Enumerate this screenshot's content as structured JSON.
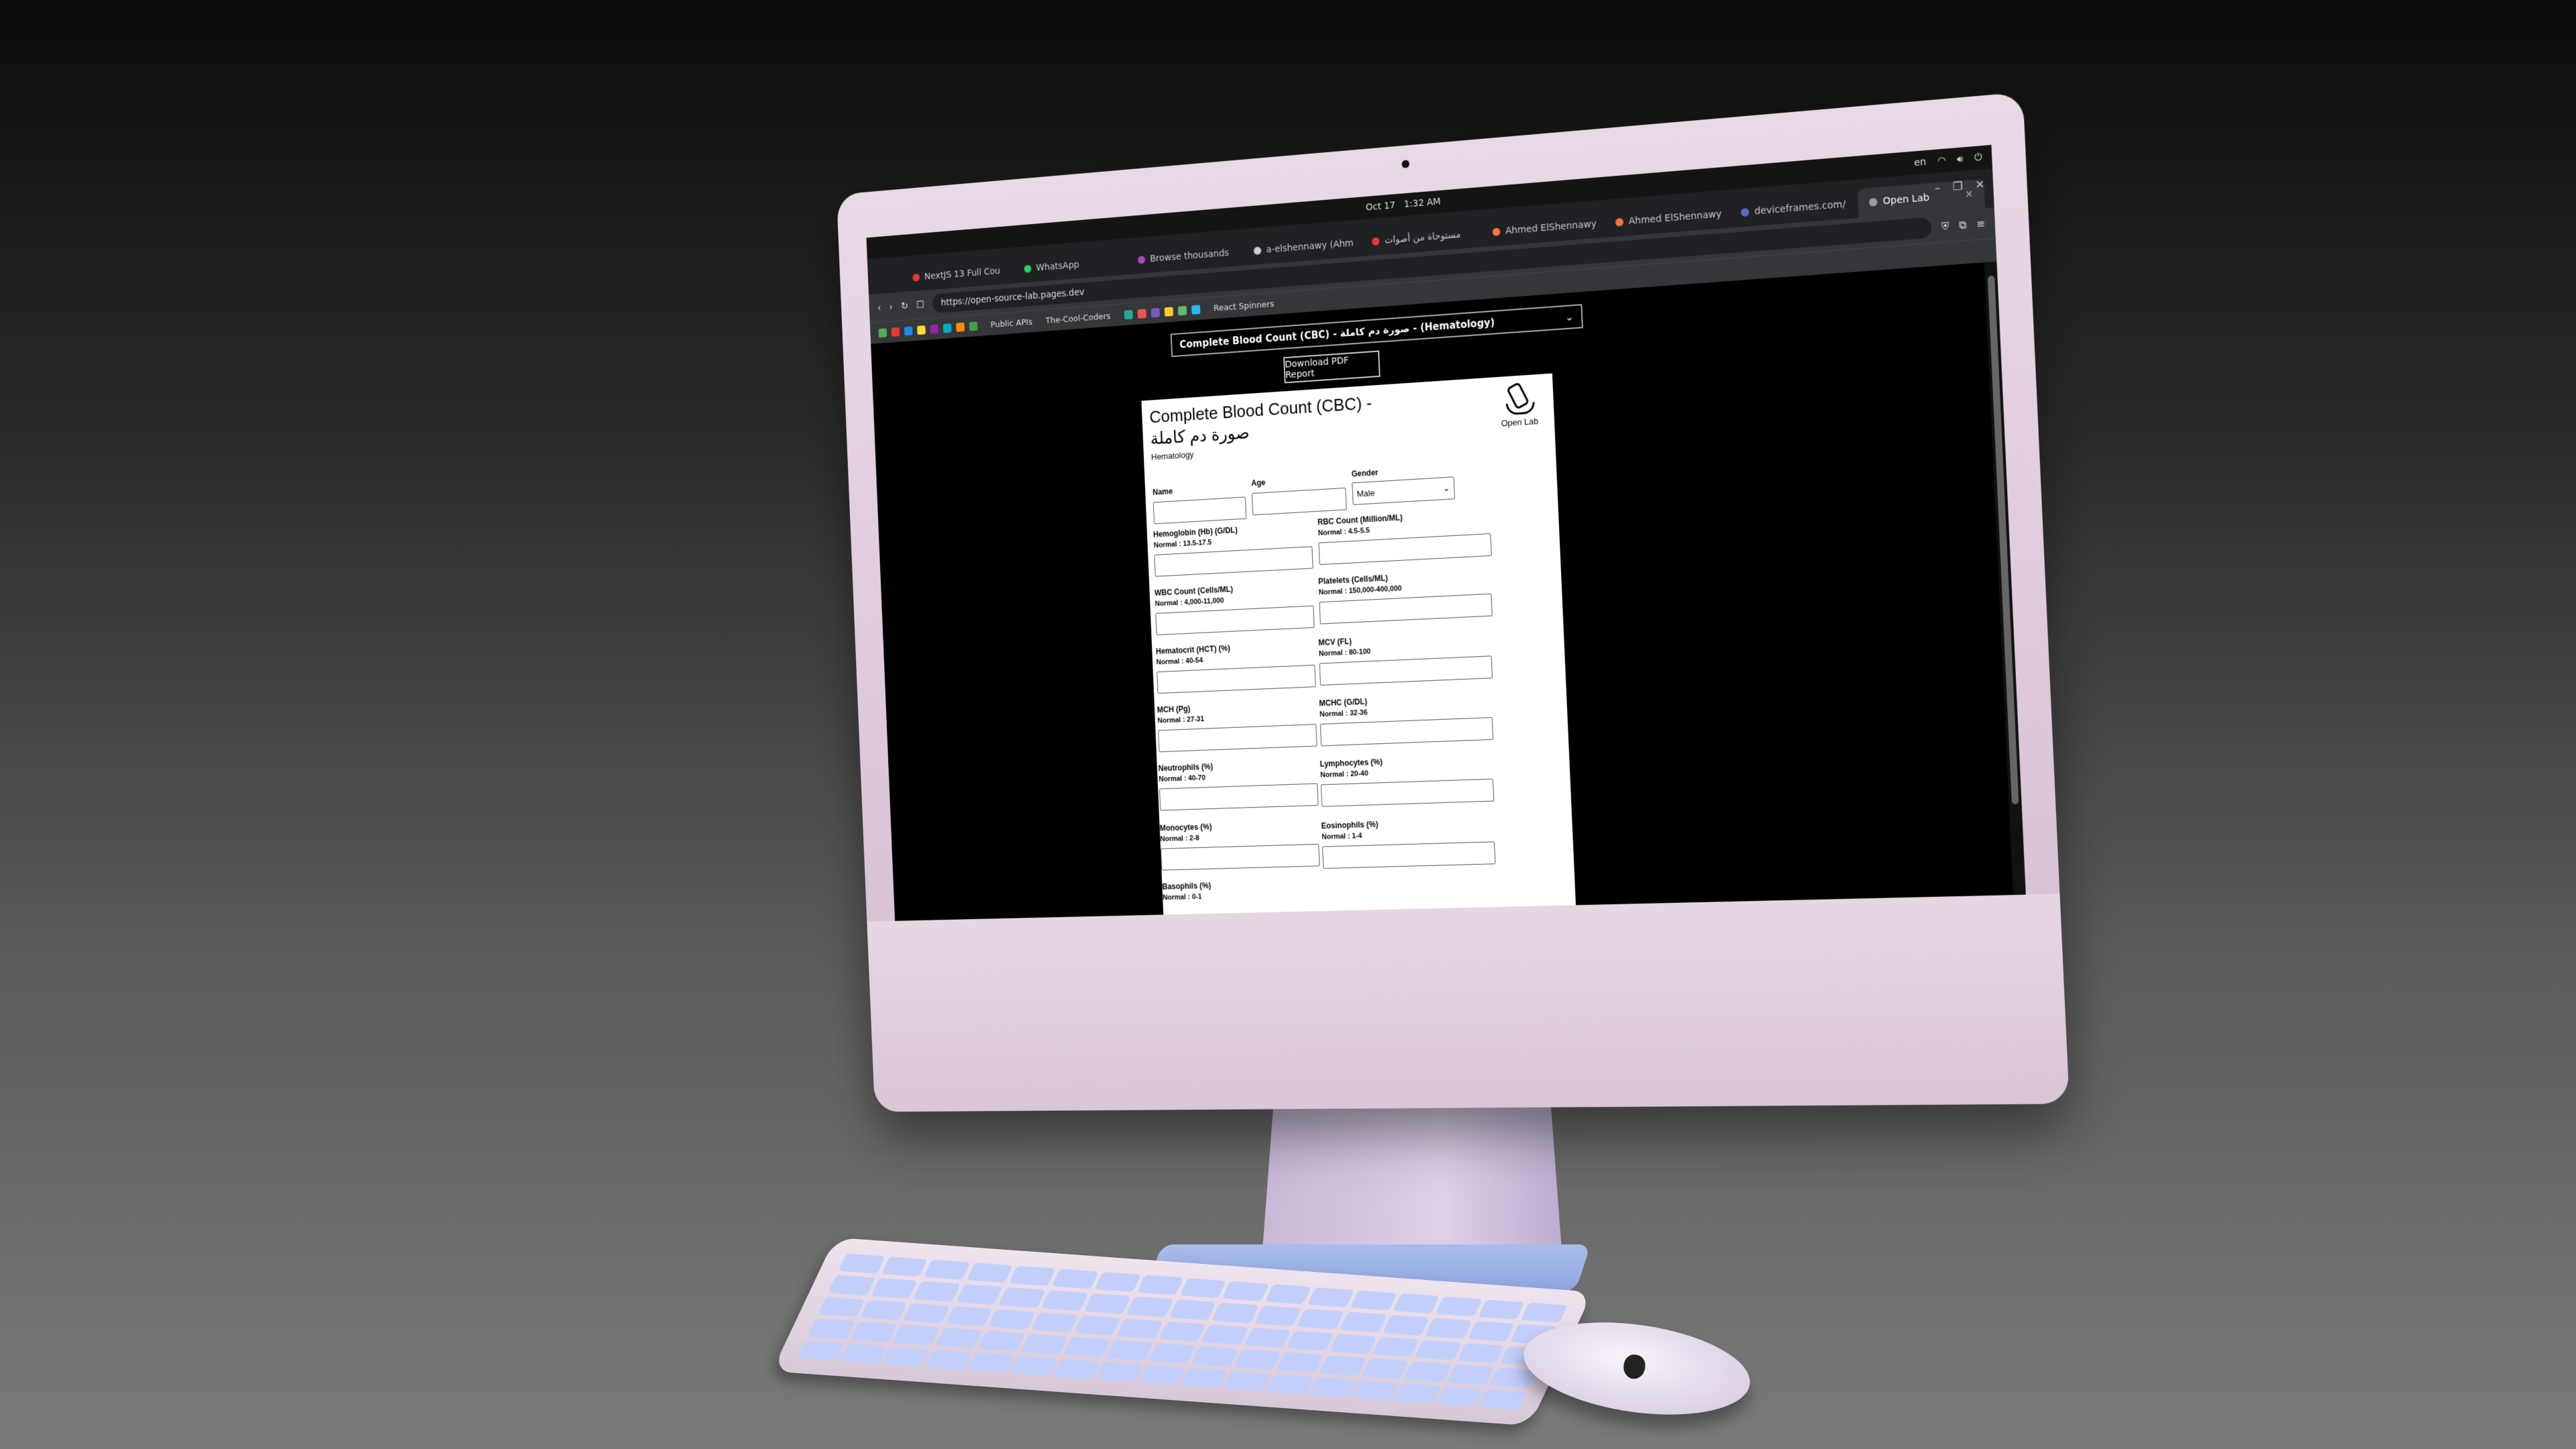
{
  "system": {
    "date": "Oct 17",
    "time": "1:32 AM",
    "keyboard_layout": "en"
  },
  "browser": {
    "tabs": [
      {
        "label": "NextJS 13 Full Cou",
        "color": "#e53935"
      },
      {
        "label": "WhatsApp",
        "color": "#25d366"
      },
      {
        "label": "Browse thousands",
        "color": "#ab47bc"
      },
      {
        "label": "a-elshennawy (Ahm",
        "color": "#cccccc"
      },
      {
        "label": "مستوحاة من أصوات",
        "color": "#e53935"
      },
      {
        "label": "Ahmed ElShennawy",
        "color": "#ff7043"
      },
      {
        "label": "Ahmed ElShennawy",
        "color": "#ff7043"
      },
      {
        "label": "deviceframes.com/",
        "color": "#5c6bc0"
      },
      {
        "label": "Open Lab",
        "color": "#9e9e9e",
        "active": true
      }
    ],
    "url": "https://open-source-lab.pages.dev",
    "bookmarks": [
      "Public APIs",
      "The-Cool-Coders",
      "React Spinners"
    ]
  },
  "page": {
    "selected_test": "Complete Blood Count (CBC) - صورة دم كاملة - (Hematology)",
    "download_button": "Download PDF Report",
    "report": {
      "title": "Complete Blood Count (CBC) - صورة دم كاملة",
      "category": "Hematology",
      "logo_label": "Open Lab",
      "patient": {
        "name_label": "Name",
        "age_label": "Age",
        "gender_label": "Gender",
        "gender_value": "Male"
      },
      "tests": [
        {
          "label": "Hemoglobin (Hb) (G/DL)",
          "normal": "Normal : 13.5-17.5"
        },
        {
          "label": "RBC Count (Million/ML)",
          "normal": "Normal : 4.5-5.5"
        },
        {
          "label": "WBC Count (Cells/ML)",
          "normal": "Normal : 4,000-11,000"
        },
        {
          "label": "Platelets (Cells/ML)",
          "normal": "Normal : 150,000-400,000"
        },
        {
          "label": "Hematocrit (HCT) (%)",
          "normal": "Normal : 40-54"
        },
        {
          "label": "MCV (FL)",
          "normal": "Normal : 80-100"
        },
        {
          "label": "MCH (Pg)",
          "normal": "Normal : 27-31"
        },
        {
          "label": "MCHC (G/DL)",
          "normal": "Normal : 32-36"
        },
        {
          "label": "Neutrophils (%)",
          "normal": "Normal : 40-70"
        },
        {
          "label": "Lymphocytes (%)",
          "normal": "Normal : 20-40"
        },
        {
          "label": "Monocytes (%)",
          "normal": "Normal : 2-8"
        },
        {
          "label": "Eosinophils (%)",
          "normal": "Normal : 1-4"
        },
        {
          "label": "Basophils (%)",
          "normal": "Normal : 0-1"
        }
      ]
    }
  }
}
